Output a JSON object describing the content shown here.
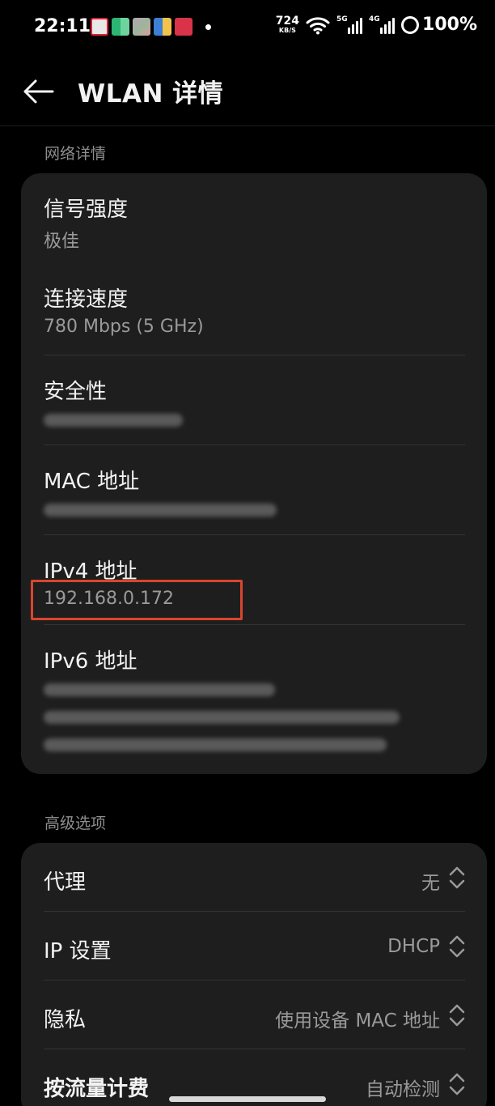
{
  "status_bar": {
    "time": "22:11",
    "net_speed_value": "724",
    "net_speed_unit": "KB/S",
    "sim1_tag": "5G",
    "sim2_tag": "4G",
    "battery": "100%"
  },
  "header": {
    "title": "WLAN 详情"
  },
  "network_details": {
    "section_label": "网络详情",
    "items": [
      {
        "title": "信号强度",
        "value": "极佳"
      },
      {
        "title": "连接速度",
        "value": "780 Mbps (5 GHz)"
      },
      {
        "title": "安全性",
        "value": ""
      },
      {
        "title": "MAC 地址",
        "value": ""
      },
      {
        "title": "IPv4 地址",
        "value": "192.168.0.172"
      },
      {
        "title": "IPv6 地址",
        "value": ""
      }
    ]
  },
  "advanced": {
    "section_label": "高级选项",
    "items": [
      {
        "title": "代理",
        "value": "无"
      },
      {
        "title": "IP 设置",
        "value": "DHCP"
      },
      {
        "title": "隐私",
        "value": "使用设备 MAC 地址"
      },
      {
        "title": "按流量计费",
        "value": "自动检测"
      }
    ]
  },
  "colors": {
    "background": "#000000",
    "card": "#1e1e1e",
    "highlight": "#d9452f"
  }
}
